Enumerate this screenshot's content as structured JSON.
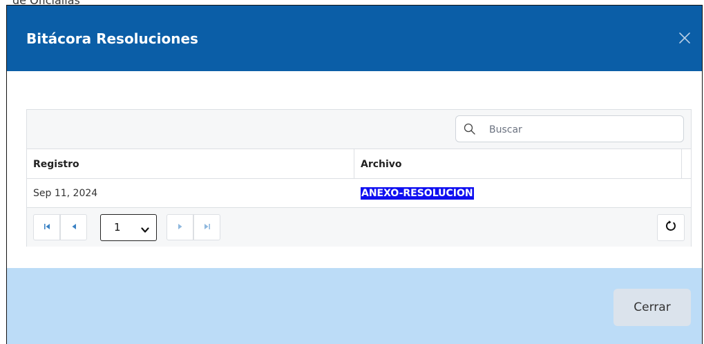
{
  "background_text": "de Oficialías",
  "modal": {
    "title": "Bitácora Resoluciones",
    "close_icon": "close-icon",
    "header_color": "#0b5ea7",
    "footer_color": "#bcdcf7"
  },
  "grid": {
    "search": {
      "placeholder": "Buscar",
      "value": "",
      "icon": "search-icon"
    },
    "columns": [
      "Registro",
      "Archivo"
    ],
    "rows": [
      {
        "registro": "Sep 11, 2024",
        "archivo": "ANEXO-RESOLUCION"
      }
    ],
    "pager": {
      "first_icon": "first-page-icon",
      "prev_icon": "prev-page-icon",
      "next_icon": "next-page-icon",
      "last_icon": "last-page-icon",
      "current_page": "1",
      "refresh_icon": "refresh-icon"
    }
  },
  "footer": {
    "close_label": "Cerrar"
  }
}
